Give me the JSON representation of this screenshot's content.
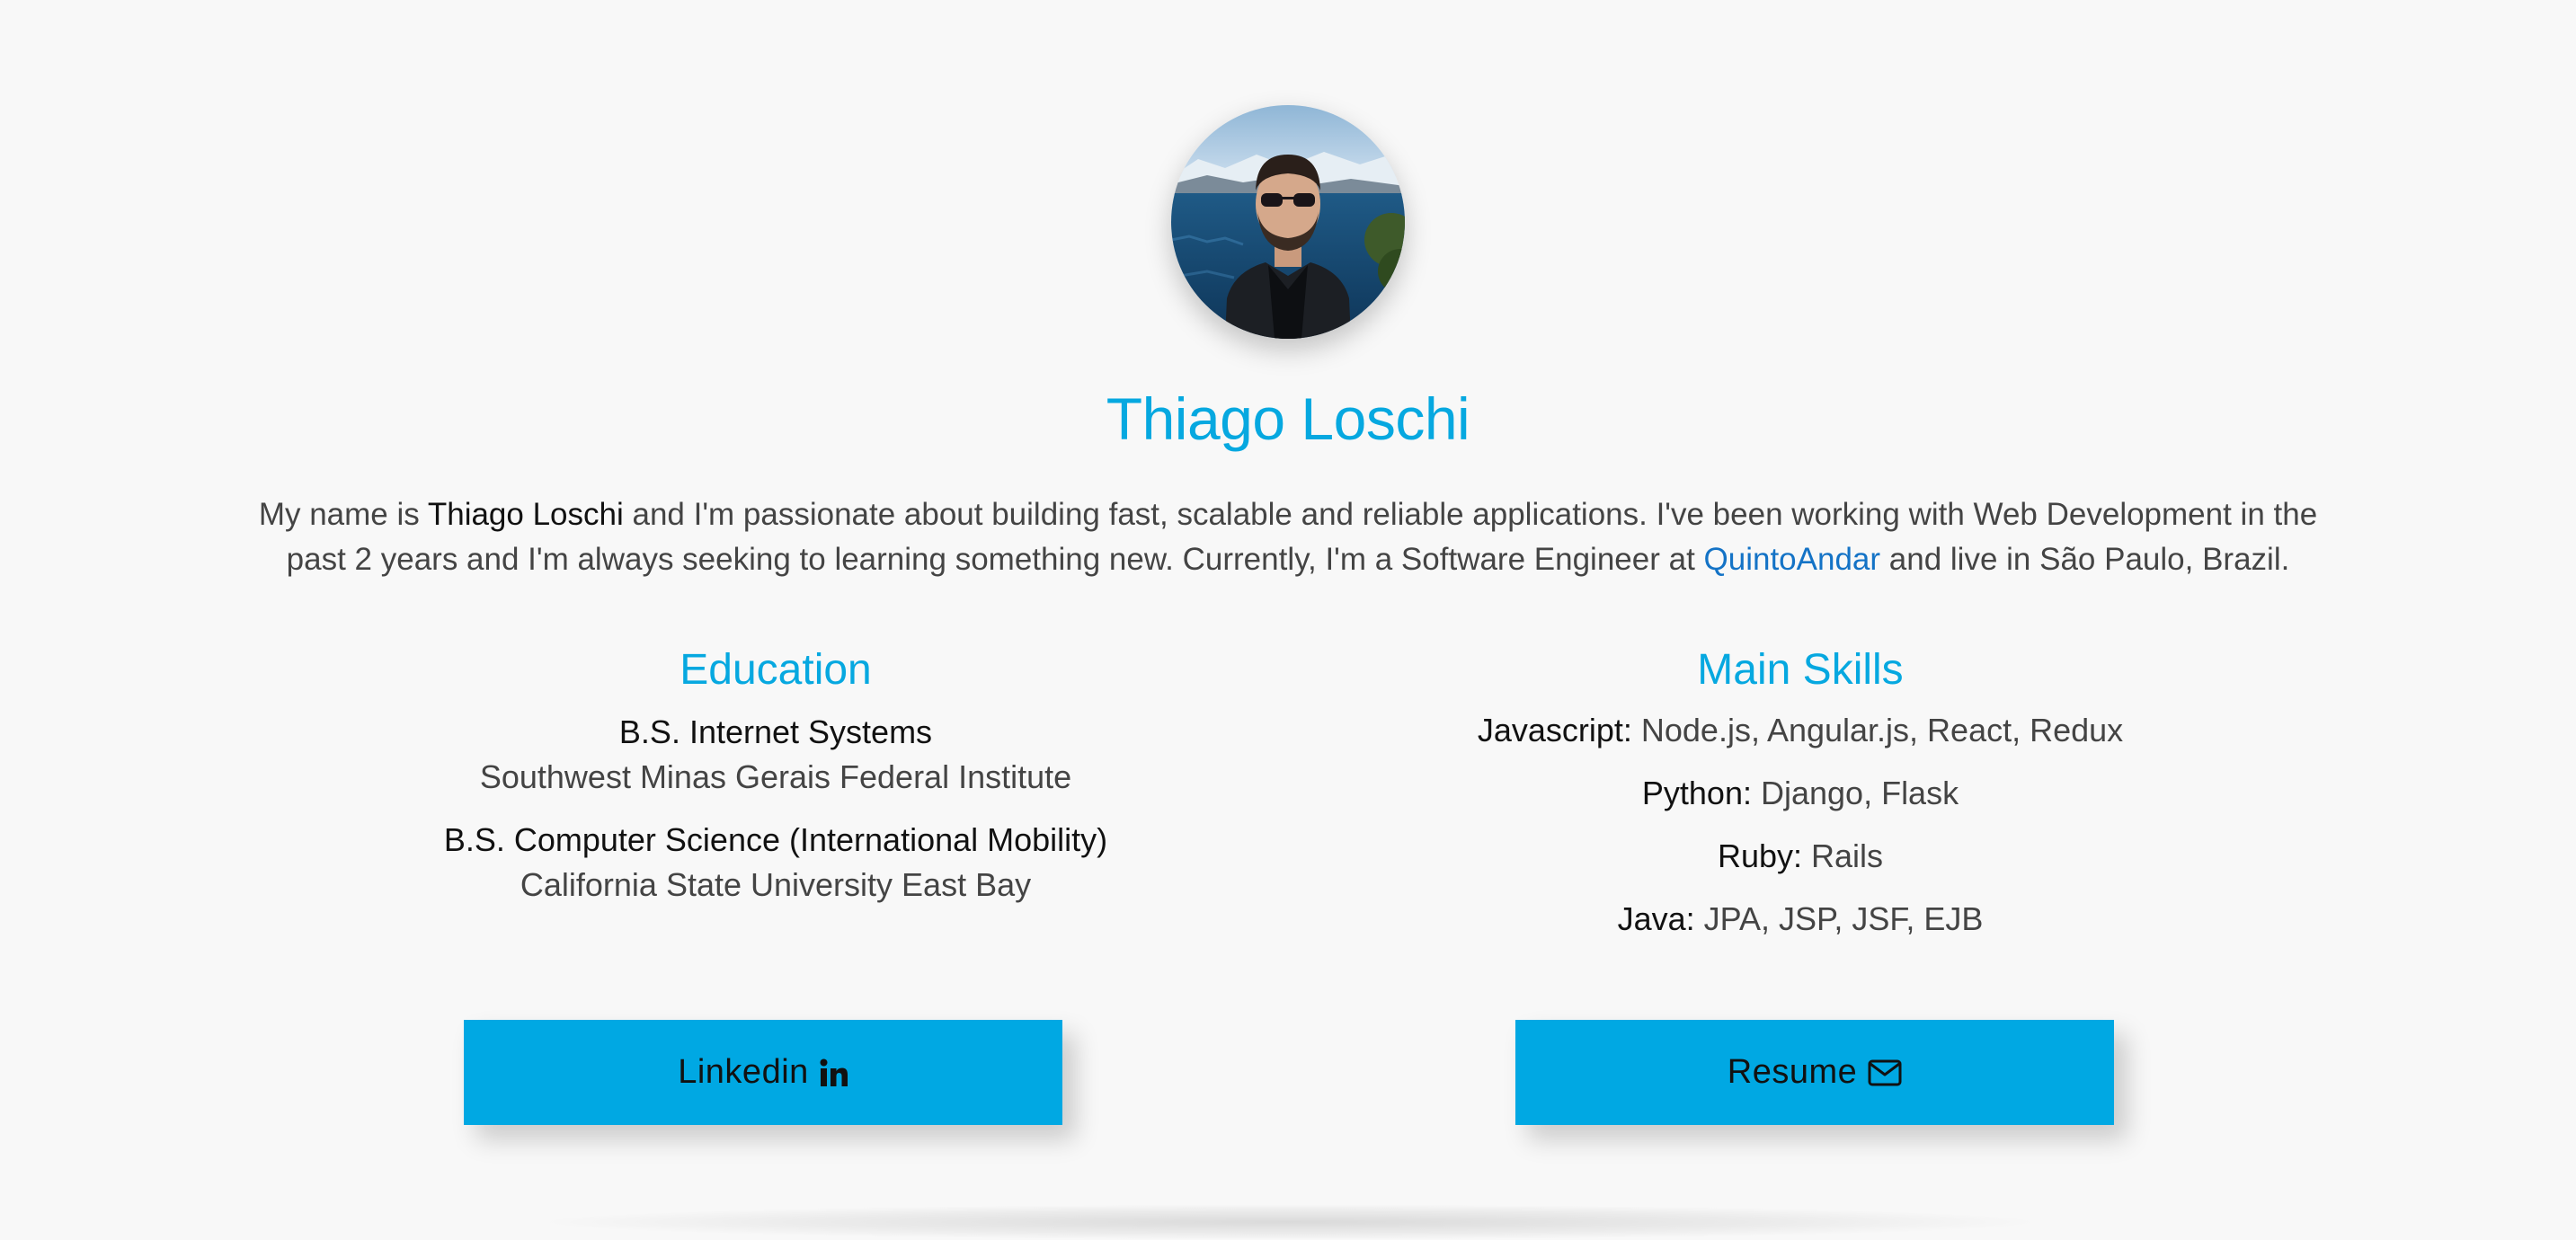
{
  "profile": {
    "name": "Thiago Loschi",
    "avatar_alt": "Thiago Loschi"
  },
  "bio": {
    "part1": "My name is ",
    "name_strong": "Thiago Loschi",
    "part2": " and I'm passionate about building fast, scalable and reliable applications. I've been working with Web Development in the past 2 years and I'm always seeking to learning something new. Currently, I'm a Software Engineer at ",
    "company_link": "QuintoAndar",
    "part3": " and live in São Paulo, Brazil."
  },
  "education": {
    "title": "Education",
    "items": [
      {
        "degree": "B.S. Internet Systems",
        "school": "Southwest Minas Gerais Federal Institute"
      },
      {
        "degree": "B.S. Computer Science (International Mobility)",
        "school": "California State University East Bay"
      }
    ]
  },
  "skills": {
    "title": "Main Skills",
    "items": [
      {
        "label": "Javascript:",
        "value": " Node.js, Angular.js, React, Redux"
      },
      {
        "label": "Python:",
        "value": " Django, Flask"
      },
      {
        "label": "Ruby:",
        "value": " Rails"
      },
      {
        "label": "Java:",
        "value": " JPA, JSP, JSF, EJB"
      }
    ]
  },
  "buttons": {
    "linkedin_label": "Linkedin",
    "linkedin_icon": "linkedin-icon",
    "resume_label": "Resume",
    "resume_icon": "envelope-icon"
  },
  "colors": {
    "accent": "#06a8e0",
    "button": "#00a8e3",
    "link": "#1473c6",
    "background": "#f8f8f8"
  }
}
